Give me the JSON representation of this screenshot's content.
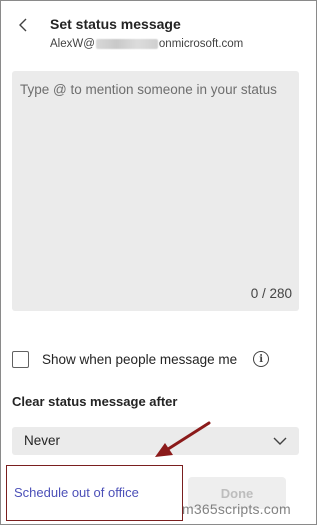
{
  "header": {
    "title": "Set status message",
    "account_prefix": "AlexW@",
    "account_suffix": "onmicrosoft.com",
    "back_icon": "chevron-left-icon"
  },
  "message": {
    "placeholder": "Type @ to mention someone in your status",
    "counter": "0 / 280"
  },
  "options": {
    "show_when_label": "Show when people message me",
    "show_when_checked": false,
    "info_icon": "info-icon"
  },
  "clear": {
    "label": "Clear status message after",
    "selected": "Never",
    "chevron_icon": "chevron-down-icon"
  },
  "footer": {
    "schedule_link": "Schedule out of office",
    "done_label": "Done",
    "done_enabled": false
  },
  "annotation": {
    "arrow_color": "#8b1a1a",
    "highlight_color": "#7a1f1f"
  },
  "watermark": "m365scripts.com",
  "colors": {
    "accent": "#4c50b8",
    "input_bg": "#ebebeb",
    "disabled_text": "#bdbdbd"
  }
}
